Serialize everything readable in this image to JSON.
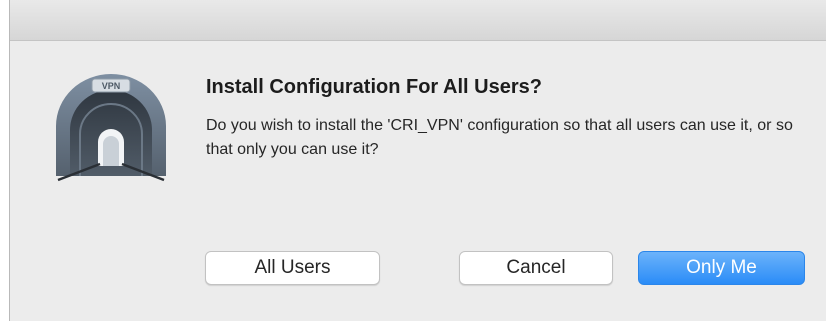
{
  "dialog": {
    "title": "Install Configuration For All Users?",
    "message": "Do you wish to install the 'CRI_VPN' configuration so that all users can use it, or so that only you can use it?",
    "icon": {
      "name": "vpn-tunnel-icon",
      "badge_text": "VPN"
    }
  },
  "buttons": {
    "all_users": "All Users",
    "cancel": "Cancel",
    "only_me": "Only Me"
  },
  "colors": {
    "primary_button": "#2a8cf7",
    "dialog_background": "#ececec"
  }
}
